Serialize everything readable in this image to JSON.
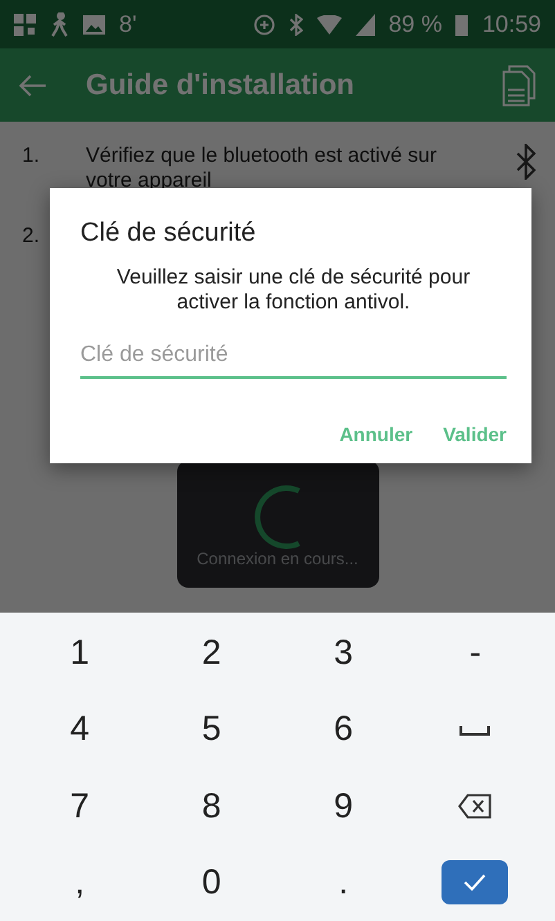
{
  "status_bar": {
    "left": [
      "8'"
    ],
    "battery": "89 %",
    "time": "10:59"
  },
  "app_bar": {
    "title": "Guide d'installation"
  },
  "steps": [
    {
      "number": "1.",
      "text": "Vérifiez que le bluetooth est activé sur votre appareil"
    },
    {
      "number": "2."
    }
  ],
  "loading": {
    "text": "Connexion en cours..."
  },
  "dialog": {
    "title": "Clé de sécurité",
    "message": "Veuillez saisir une clé de sécurité pour activer la fonction antivol.",
    "input": {
      "placeholder": "Clé de sécurité",
      "focused": true
    },
    "buttons": [
      "Annuler",
      "Valider"
    ]
  },
  "keyboard": {
    "rows": [
      [
        {
          "kind": "char",
          "label": "1"
        },
        {
          "kind": "char",
          "label": "2"
        },
        {
          "kind": "char",
          "label": "3"
        },
        {
          "kind": "char",
          "label": "-"
        }
      ],
      [
        {
          "kind": "char",
          "label": "4"
        },
        {
          "kind": "char",
          "label": "5"
        },
        {
          "kind": "char",
          "label": "6"
        },
        {
          "kind": "space"
        }
      ],
      [
        {
          "kind": "char",
          "label": "7"
        },
        {
          "kind": "char",
          "label": "8"
        },
        {
          "kind": "char",
          "label": "9"
        },
        {
          "kind": "backspace"
        }
      ],
      [
        {
          "kind": "char",
          "label": ","
        },
        {
          "kind": "char",
          "label": "0"
        },
        {
          "kind": "char",
          "label": "."
        },
        {
          "kind": "enter"
        }
      ]
    ]
  }
}
